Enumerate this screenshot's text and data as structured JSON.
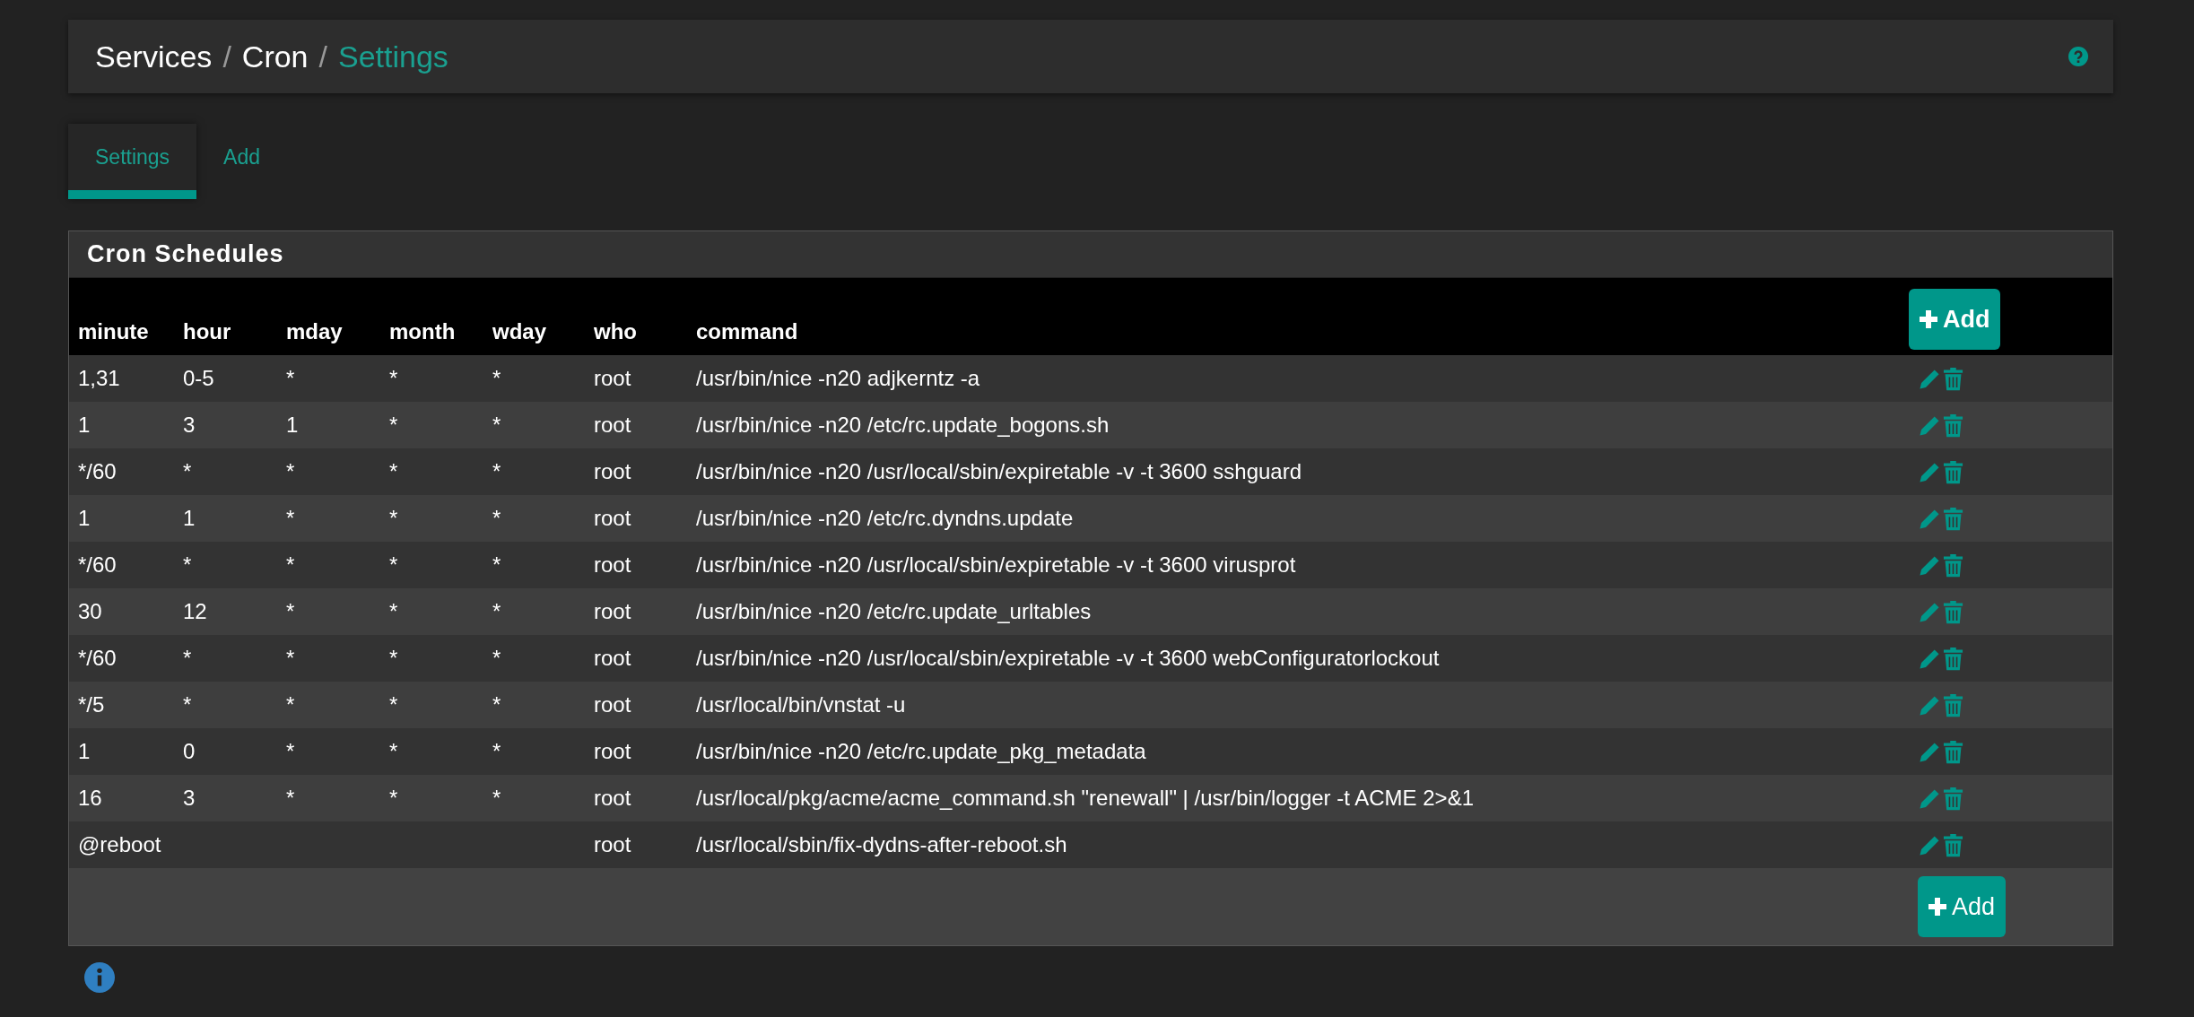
{
  "breadcrumb": [
    {
      "label": "Services",
      "current": false,
      "separator": "/"
    },
    {
      "label": "Cron",
      "current": false,
      "separator": "/"
    },
    {
      "label": "Settings",
      "current": true
    }
  ],
  "tabs": [
    {
      "label": "Settings",
      "selected": true
    },
    {
      "label": "Add",
      "selected": false
    }
  ],
  "panel": {
    "title": "Cron Schedules",
    "columns": [
      "minute",
      "hour",
      "mday",
      "month",
      "wday",
      "who",
      "command"
    ],
    "add_button": "Add",
    "rows": [
      {
        "cells": [
          "1,31",
          "0-5",
          "*",
          "*",
          "*"
        ],
        "who": "root",
        "command": "/usr/bin/nice -n20 adjkerntz -a"
      },
      {
        "cells": [
          "1",
          "3",
          "1",
          "*",
          "*"
        ],
        "who": "root",
        "command": "/usr/bin/nice -n20 /etc/rc.update_bogons.sh"
      },
      {
        "cells": [
          "*/60",
          "*",
          "*",
          "*",
          "*"
        ],
        "who": "root",
        "command": "/usr/bin/nice -n20 /usr/local/sbin/expiretable -v -t 3600 sshguard"
      },
      {
        "cells": [
          "1",
          "1",
          "*",
          "*",
          "*"
        ],
        "who": "root",
        "command": "/usr/bin/nice -n20 /etc/rc.dyndns.update"
      },
      {
        "cells": [
          "*/60",
          "*",
          "*",
          "*",
          "*"
        ],
        "who": "root",
        "command": "/usr/bin/nice -n20 /usr/local/sbin/expiretable -v -t 3600 virusprot"
      },
      {
        "cells": [
          "30",
          "12",
          "*",
          "*",
          "*"
        ],
        "who": "root",
        "command": "/usr/bin/nice -n20 /etc/rc.update_urltables"
      },
      {
        "cells": [
          "*/60",
          "*",
          "*",
          "*",
          "*"
        ],
        "who": "root",
        "command": "/usr/bin/nice -n20 /usr/local/sbin/expiretable -v -t 3600 webConfiguratorlockout"
      },
      {
        "cells": [
          "*/5",
          "*",
          "*",
          "*",
          "*"
        ],
        "who": "root",
        "command": "/usr/local/bin/vnstat -u"
      },
      {
        "cells": [
          "1",
          "0",
          "*",
          "*",
          "*"
        ],
        "who": "root",
        "command": "/usr/bin/nice -n20 /etc/rc.update_pkg_metadata"
      },
      {
        "cells": [
          "16",
          "3",
          "*",
          "*",
          "*"
        ],
        "who": "root",
        "command": "/usr/local/pkg/acme/acme_command.sh \"renewall\" | /usr/bin/logger -t ACME 2>&1"
      },
      {
        "special": "@reboot",
        "who": "root",
        "command": "/usr/local/sbin/fix-dydns-after-reboot.sh"
      }
    ],
    "footer_button": "Add"
  }
}
